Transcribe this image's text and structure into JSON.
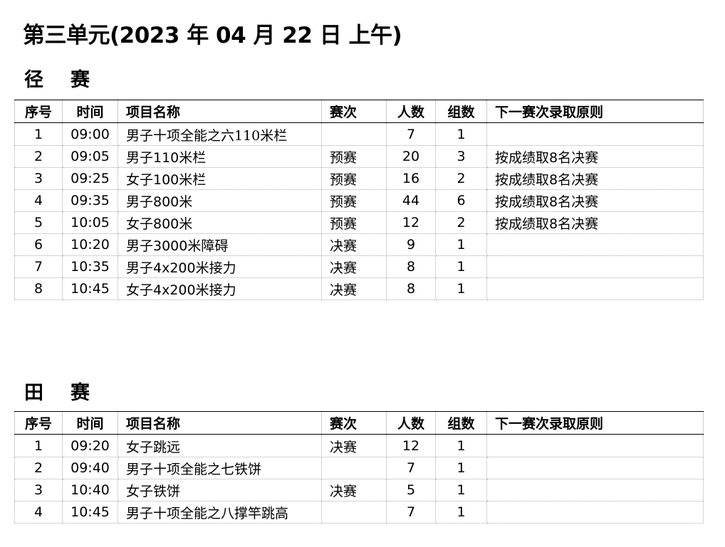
{
  "page": {
    "title": "第三单元(2023 年 04 月 22 日  上午)"
  },
  "headers": [
    "序号",
    "时间",
    "项目名称",
    "赛次",
    "人数",
    "组数",
    "下一赛次录取原则"
  ],
  "track": {
    "title": "径赛",
    "rows": [
      {
        "no": "1",
        "time": "09:00",
        "event": "男子十项全能之六110米栏",
        "round": "",
        "count": "7",
        "groups": "1",
        "rule": ""
      },
      {
        "no": "2",
        "time": "09:05",
        "event": "男子110米栏",
        "round": "预赛",
        "count": "20",
        "groups": "3",
        "rule": "按成绩取8名决赛"
      },
      {
        "no": "3",
        "time": "09:25",
        "event": "女子100米栏",
        "round": "预赛",
        "count": "16",
        "groups": "2",
        "rule": "按成绩取8名决赛"
      },
      {
        "no": "4",
        "time": "09:35",
        "event": "男子800米",
        "round": "预赛",
        "count": "44",
        "groups": "6",
        "rule": "按成绩取8名决赛"
      },
      {
        "no": "5",
        "time": "10:05",
        "event": "女子800米",
        "round": "预赛",
        "count": "12",
        "groups": "2",
        "rule": "按成绩取8名决赛"
      },
      {
        "no": "6",
        "time": "10:20",
        "event": "男子3000米障碍",
        "round": "决赛",
        "count": "9",
        "groups": "1",
        "rule": ""
      },
      {
        "no": "7",
        "time": "10:35",
        "event": "男子4x200米接力",
        "round": "决赛",
        "count": "8",
        "groups": "1",
        "rule": ""
      },
      {
        "no": "8",
        "time": "10:45",
        "event": "女子4x200米接力",
        "round": "决赛",
        "count": "8",
        "groups": "1",
        "rule": ""
      }
    ]
  },
  "field": {
    "title": "田赛",
    "rows": [
      {
        "no": "1",
        "time": "09:20",
        "event": "女子跳远",
        "round": "决赛",
        "count": "12",
        "groups": "1",
        "rule": ""
      },
      {
        "no": "2",
        "time": "09:40",
        "event": "男子十项全能之七铁饼",
        "round": "",
        "count": "7",
        "groups": "1",
        "rule": ""
      },
      {
        "no": "3",
        "time": "10:40",
        "event": "女子铁饼",
        "round": "决赛",
        "count": "5",
        "groups": "1",
        "rule": ""
      },
      {
        "no": "4",
        "time": "10:45",
        "event": "男子十项全能之八撑竿跳高",
        "round": "",
        "count": "7",
        "groups": "1",
        "rule": ""
      }
    ]
  }
}
